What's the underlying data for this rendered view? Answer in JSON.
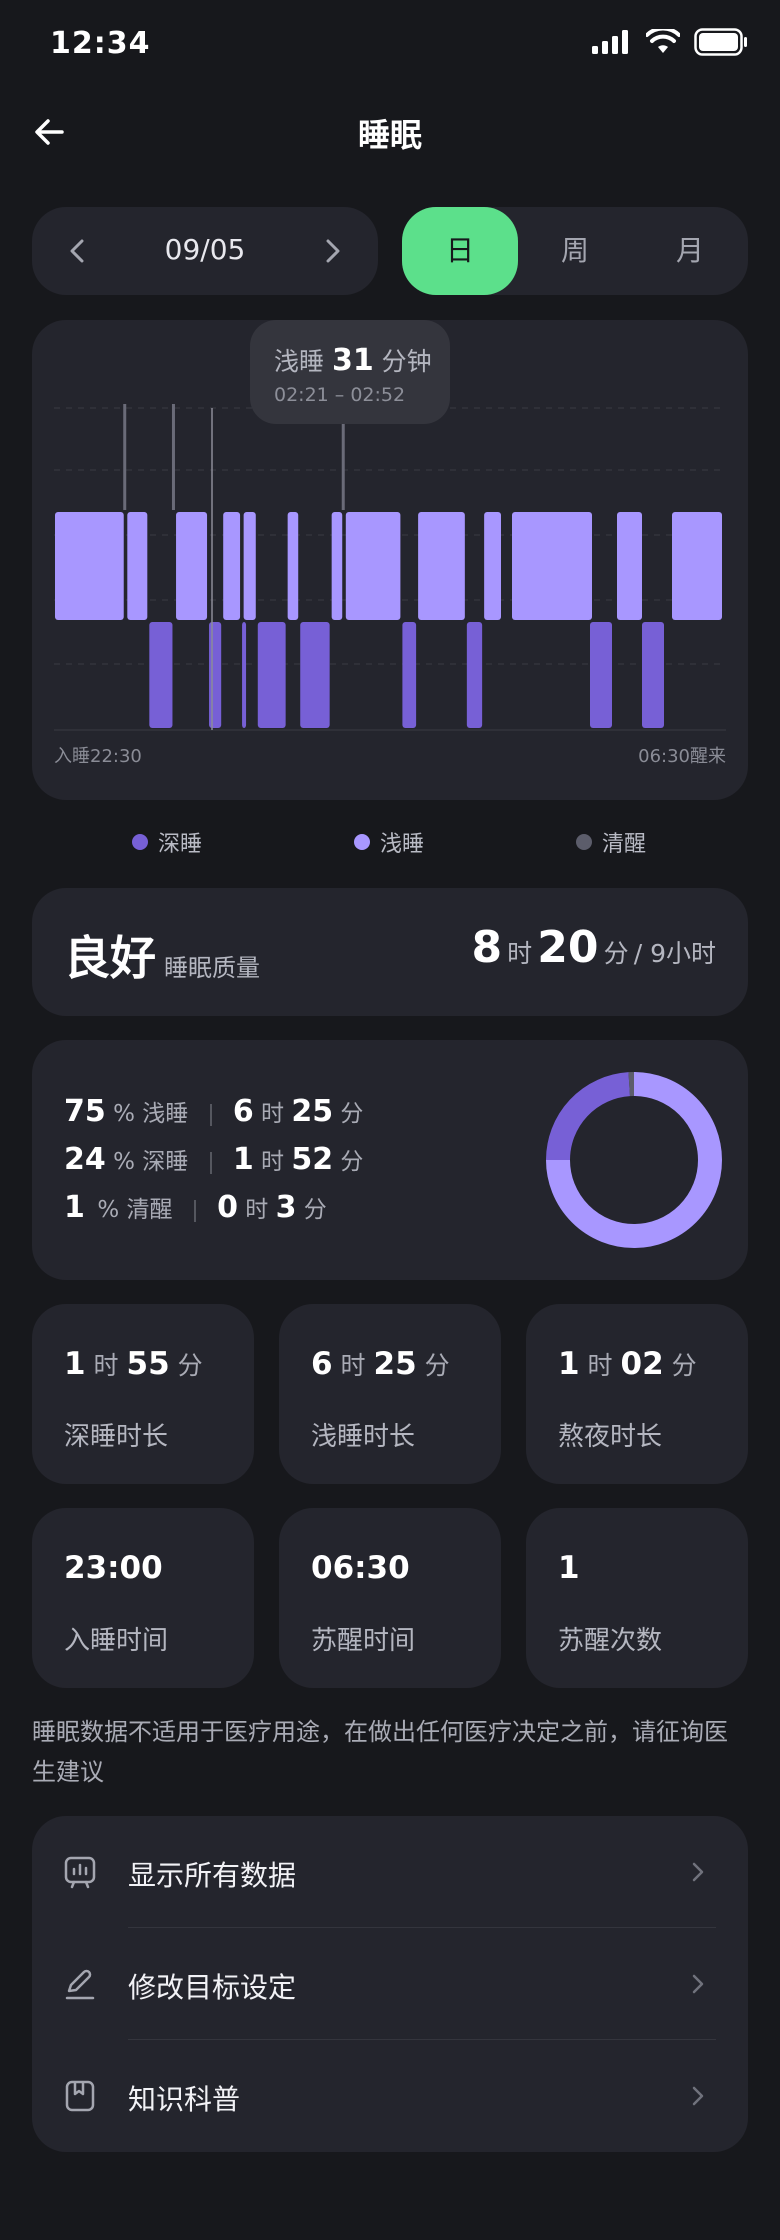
{
  "status_bar": {
    "time": "12:34"
  },
  "header": {
    "title": "睡眠"
  },
  "date_picker": {
    "date": "09/05"
  },
  "period_tabs": [
    {
      "label": "日",
      "active": true
    },
    {
      "label": "周",
      "active": false
    },
    {
      "label": "月",
      "active": false
    }
  ],
  "chart": {
    "tooltip": {
      "stage": "浅睡",
      "duration": "31",
      "unit": "分钟",
      "range": "02:21 – 02:52"
    },
    "start_label": "入睡22:30",
    "end_label": "06:30醒来"
  },
  "chart_data": {
    "type": "timeline",
    "stages": [
      "清醒",
      "浅睡",
      "深睡"
    ],
    "segments": [
      {
        "stage": "浅睡",
        "start": "22:30",
        "end": "23:15"
      },
      {
        "stage": "清醒",
        "start": "23:15",
        "end": "23:16"
      },
      {
        "stage": "浅睡",
        "start": "23:16",
        "end": "23:30"
      },
      {
        "stage": "深睡",
        "start": "23:30",
        "end": "23:46"
      },
      {
        "stage": "清醒",
        "start": "23:46",
        "end": "23:47"
      },
      {
        "stage": "浅睡",
        "start": "23:47",
        "end": "00:08"
      },
      {
        "stage": "深睡",
        "start": "00:08",
        "end": "00:17"
      },
      {
        "stage": "浅睡",
        "start": "00:17",
        "end": "00:29"
      },
      {
        "stage": "深睡",
        "start": "00:29",
        "end": "00:30"
      },
      {
        "stage": "浅睡",
        "start": "00:30",
        "end": "00:39"
      },
      {
        "stage": "深睡",
        "start": "00:39",
        "end": "00:58"
      },
      {
        "stage": "浅睡",
        "start": "00:58",
        "end": "01:06"
      },
      {
        "stage": "深睡",
        "start": "01:06",
        "end": "01:26"
      },
      {
        "stage": "浅睡",
        "start": "01:26",
        "end": "01:34"
      },
      {
        "stage": "清醒",
        "start": "01:34",
        "end": "01:35"
      },
      {
        "stage": "浅睡",
        "start": "01:35",
        "end": "02:11"
      },
      {
        "stage": "深睡",
        "start": "02:11",
        "end": "02:21"
      },
      {
        "stage": "浅睡",
        "start": "02:21",
        "end": "02:52"
      },
      {
        "stage": "深睡",
        "start": "02:52",
        "end": "03:03"
      },
      {
        "stage": "浅睡",
        "start": "03:03",
        "end": "03:15"
      }
    ],
    "start": "22:30",
    "end": "06:30"
  },
  "legend": [
    {
      "label": "深睡",
      "color": "#7760d6"
    },
    {
      "label": "浅睡",
      "color": "#a897ff"
    },
    {
      "label": "清醒",
      "color": "#5c5d6b"
    }
  ],
  "quality": {
    "label": "良好",
    "sub": "睡眠质量",
    "hours": "8",
    "h_unit": "时",
    "minutes": "20",
    "m_unit": "分",
    "goal": "/ 9小时"
  },
  "breakdown": [
    {
      "percent": "75",
      "pct_unit": "%",
      "stage": "浅睡",
      "hours": "6",
      "h_unit": "时",
      "minutes": "25",
      "m_unit": "分"
    },
    {
      "percent": "24",
      "pct_unit": "%",
      "stage": "深睡",
      "hours": "1",
      "h_unit": "时",
      "minutes": "52",
      "m_unit": "分"
    },
    {
      "percent": "1",
      "pct_unit": "%",
      "stage": "清醒",
      "hours": "0",
      "h_unit": "时",
      "minutes": "3",
      "m_unit": "分"
    }
  ],
  "donut": {
    "light": 75,
    "deep": 24,
    "awake": 1
  },
  "stats": [
    {
      "hours": "1",
      "h_unit": "时",
      "minutes": "55",
      "m_unit": "分",
      "label": "深睡时长"
    },
    {
      "hours": "6",
      "h_unit": "时",
      "minutes": "25",
      "m_unit": "分",
      "label": "浅睡时长"
    },
    {
      "hours": "1",
      "h_unit": "时",
      "minutes": "02",
      "m_unit": "分",
      "label": "熬夜时长"
    },
    {
      "value": "23:00",
      "label": "入睡时间"
    },
    {
      "value": "06:30",
      "label": "苏醒时间"
    },
    {
      "value": "1",
      "label": "苏醒次数"
    }
  ],
  "disclaimer": "睡眠数据不适用于医疗用途，在做出任何医疗决定之前，请征询医生建议",
  "menu": [
    {
      "label": "显示所有数据",
      "icon": "chart-icon"
    },
    {
      "label": "修改目标设定",
      "icon": "edit-icon"
    },
    {
      "label": "知识科普",
      "icon": "book-icon"
    }
  ]
}
